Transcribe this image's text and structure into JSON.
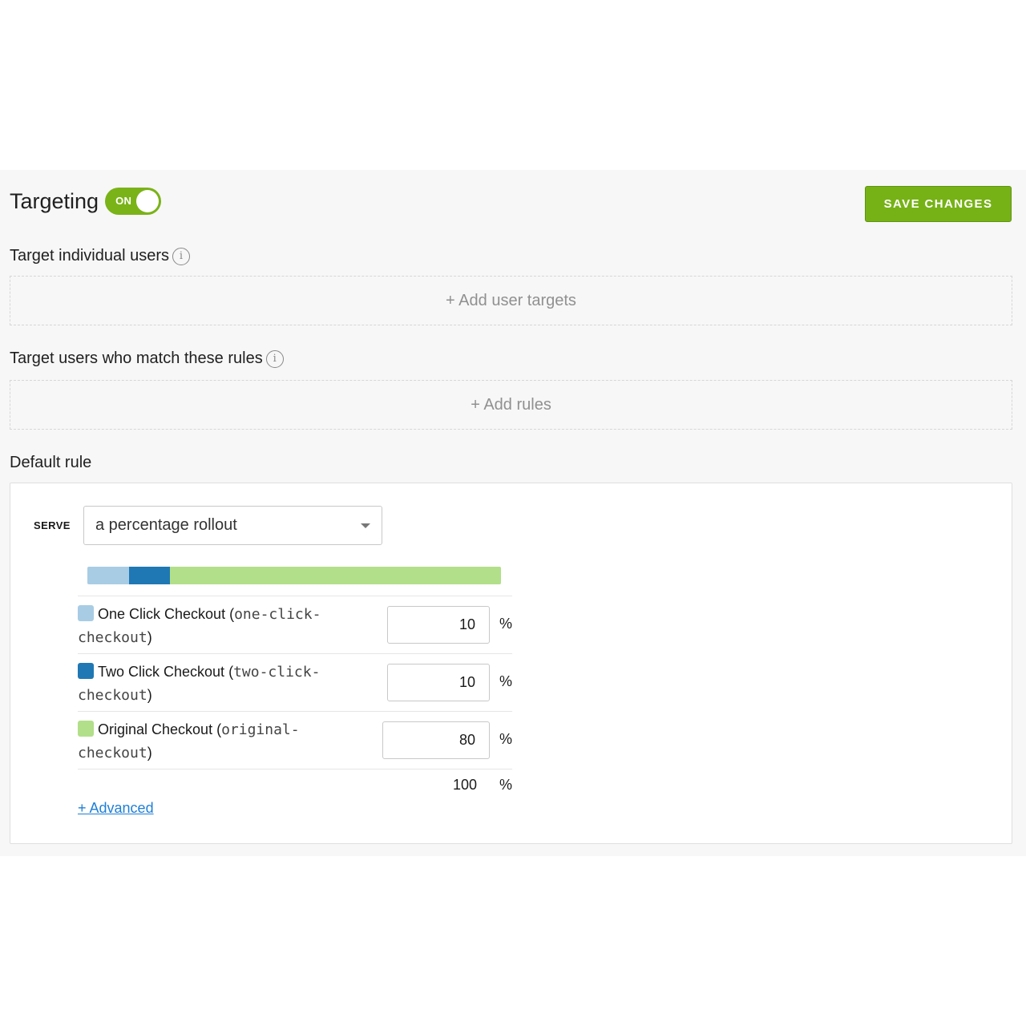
{
  "header": {
    "title": "Targeting",
    "toggle_label": "ON",
    "toggle_on": true,
    "save_label": "SAVE CHANGES"
  },
  "individual_users": {
    "label": "Target individual users",
    "add_label": "+ Add user targets"
  },
  "rules": {
    "label": "Target users who match these rules",
    "add_label": "+ Add rules"
  },
  "default_rule": {
    "label": "Default rule",
    "serve_label": "SERVE",
    "serve_value": "a percentage rollout",
    "variations": [
      {
        "name": "One Click Checkout",
        "key_start": "one-click-",
        "key_end": "checkout",
        "value": "10",
        "color": "#a8cce4"
      },
      {
        "name": "Two Click Checkout",
        "key_start": "two-click-",
        "key_end": "checkout",
        "value": "10",
        "color": "#1f78b4"
      },
      {
        "name": "Original Checkout",
        "key_start": "original-",
        "key_end": "checkout",
        "value": "80",
        "color": "#b2df8a"
      }
    ],
    "percent_symbol": "%",
    "total": "100",
    "advanced_label": "+ Advanced"
  },
  "colors": {
    "accent_green": "#7ab317",
    "link_blue": "#1f7fd6"
  }
}
